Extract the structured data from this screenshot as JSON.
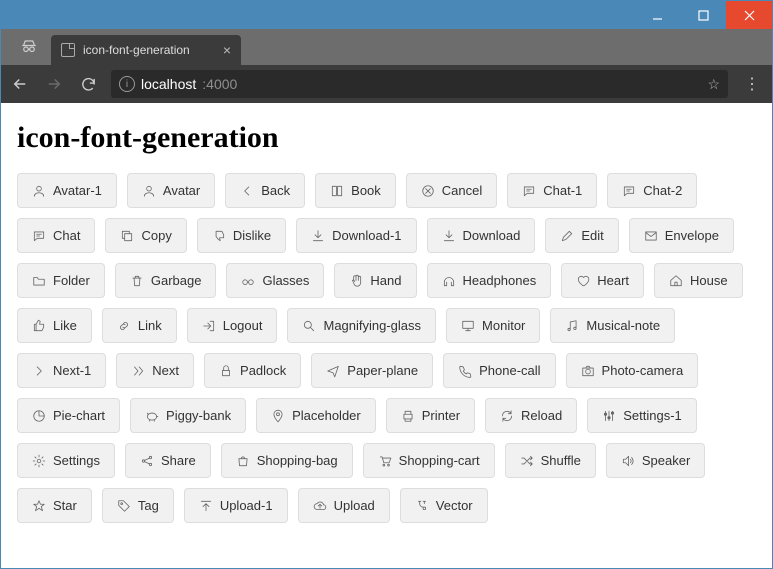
{
  "tab": {
    "title": "icon-font-generation"
  },
  "address": {
    "host": "localhost",
    "port": ":4000"
  },
  "page": {
    "heading": "icon-font-generation",
    "buttons": [
      {
        "label": "Avatar-1",
        "icon": "avatar"
      },
      {
        "label": "Avatar",
        "icon": "avatar"
      },
      {
        "label": "Back",
        "icon": "back"
      },
      {
        "label": "Book",
        "icon": "book"
      },
      {
        "label": "Cancel",
        "icon": "cancel"
      },
      {
        "label": "Chat-1",
        "icon": "chat"
      },
      {
        "label": "Chat-2",
        "icon": "chat"
      },
      {
        "label": "Chat",
        "icon": "chat"
      },
      {
        "label": "Copy",
        "icon": "copy"
      },
      {
        "label": "Dislike",
        "icon": "dislike"
      },
      {
        "label": "Download-1",
        "icon": "download"
      },
      {
        "label": "Download",
        "icon": "download"
      },
      {
        "label": "Edit",
        "icon": "edit"
      },
      {
        "label": "Envelope",
        "icon": "envelope"
      },
      {
        "label": "Folder",
        "icon": "folder"
      },
      {
        "label": "Garbage",
        "icon": "garbage"
      },
      {
        "label": "Glasses",
        "icon": "glasses"
      },
      {
        "label": "Hand",
        "icon": "hand"
      },
      {
        "label": "Headphones",
        "icon": "headphones"
      },
      {
        "label": "Heart",
        "icon": "heart"
      },
      {
        "label": "House",
        "icon": "house"
      },
      {
        "label": "Like",
        "icon": "like"
      },
      {
        "label": "Link",
        "icon": "link"
      },
      {
        "label": "Logout",
        "icon": "logout"
      },
      {
        "label": "Magnifying-glass",
        "icon": "magnify"
      },
      {
        "label": "Monitor",
        "icon": "monitor"
      },
      {
        "label": "Musical-note",
        "icon": "music"
      },
      {
        "label": "Next-1",
        "icon": "next"
      },
      {
        "label": "Next",
        "icon": "next2"
      },
      {
        "label": "Padlock",
        "icon": "padlock"
      },
      {
        "label": "Paper-plane",
        "icon": "plane"
      },
      {
        "label": "Phone-call",
        "icon": "phone"
      },
      {
        "label": "Photo-camera",
        "icon": "camera"
      },
      {
        "label": "Pie-chart",
        "icon": "pie"
      },
      {
        "label": "Piggy-bank",
        "icon": "piggy"
      },
      {
        "label": "Placeholder",
        "icon": "placeholder"
      },
      {
        "label": "Printer",
        "icon": "printer"
      },
      {
        "label": "Reload",
        "icon": "reload"
      },
      {
        "label": "Settings-1",
        "icon": "settings1"
      },
      {
        "label": "Settings",
        "icon": "settings"
      },
      {
        "label": "Share",
        "icon": "share"
      },
      {
        "label": "Shopping-bag",
        "icon": "bag"
      },
      {
        "label": "Shopping-cart",
        "icon": "cart"
      },
      {
        "label": "Shuffle",
        "icon": "shuffle"
      },
      {
        "label": "Speaker",
        "icon": "speaker"
      },
      {
        "label": "Star",
        "icon": "star"
      },
      {
        "label": "Tag",
        "icon": "tag"
      },
      {
        "label": "Upload-1",
        "icon": "upload"
      },
      {
        "label": "Upload",
        "icon": "upload2"
      },
      {
        "label": "Vector",
        "icon": "vector"
      }
    ]
  }
}
